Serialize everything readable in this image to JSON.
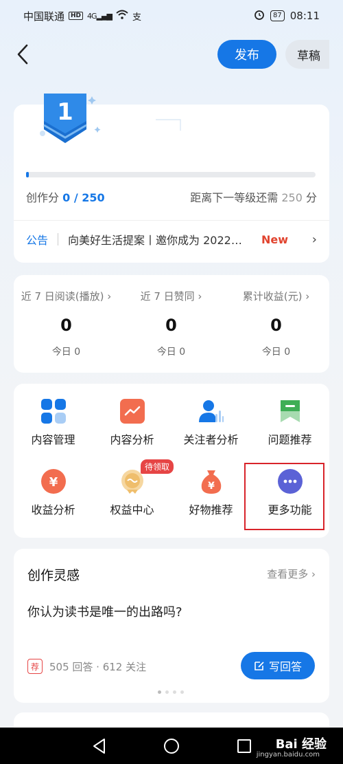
{
  "status_bar": {
    "carrier": "中国联通",
    "hd": "HD",
    "signal": "4G",
    "battery": "87",
    "time": "08:11"
  },
  "topbar": {
    "publish_label": "发布",
    "draft_label": "草稿"
  },
  "level": {
    "level_number": "1",
    "score_label": "创作分",
    "score_value": "0 / 250",
    "next_level_text": "距离下一等级还需",
    "next_level_points": "250",
    "next_level_unit": "分",
    "progress_fraction": 0.01
  },
  "notice": {
    "tag": "公告",
    "text": "向美好生活提案丨邀你成为 2022…",
    "new_label": "New"
  },
  "stats": [
    {
      "label": "近 7 日阅读(播放) ›",
      "value": "0",
      "today": "今日  0"
    },
    {
      "label": "近 7 日赞同 ›",
      "value": "0",
      "today": "今日  0"
    },
    {
      "label": "累计收益(元) ›",
      "value": "0",
      "today": "今日  0"
    }
  ],
  "grid": {
    "items": [
      {
        "label": "内容管理",
        "icon": "grid-icon"
      },
      {
        "label": "内容分析",
        "icon": "trend-chart-icon"
      },
      {
        "label": "关注者分析",
        "icon": "user-chart-icon"
      },
      {
        "label": "问题推荐",
        "icon": "bookmark-icon"
      },
      {
        "label": "收益分析",
        "icon": "yuan-icon"
      },
      {
        "label": "权益中心",
        "icon": "medal-icon"
      },
      {
        "label": "好物推荐",
        "icon": "money-bag-icon"
      },
      {
        "label": "更多功能",
        "icon": "more-icon"
      }
    ],
    "pending_badge": "待领取"
  },
  "inspiration": {
    "title": "创作灵感",
    "more_label": "查看更多 ›",
    "question": "你认为读书是唯一的出路吗?",
    "rec_tag": "荐",
    "meta": "505 回答 · 612 关注",
    "answer_label": "写回答"
  },
  "watermark": {
    "brand": "Bai 经验",
    "url": "jingyan.baidu.com"
  },
  "colors": {
    "accent": "#1677e6",
    "new_red": "#e1442f",
    "highlight": "#d8232a"
  }
}
